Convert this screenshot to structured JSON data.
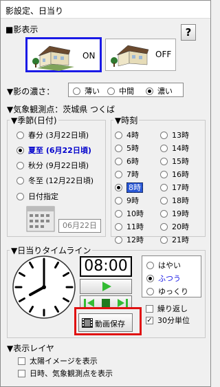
{
  "window": {
    "title": "影設定、日当り"
  },
  "shadow_display": {
    "title": "■影表示",
    "help_label": "?",
    "on_label": "ON",
    "off_label": "OFF"
  },
  "density": {
    "label": "▼影の濃さ：",
    "options": [
      "薄い",
      "中間",
      "濃い"
    ],
    "selected": "濃い"
  },
  "station": {
    "label": "▼気象観測点：茨城県 つくば"
  },
  "season": {
    "title": "▼季節(日付)",
    "options": [
      "春分 (3月22日頃)",
      "夏至 (6月22日頃)",
      "秋分 (9月22日頃)",
      "冬至 (12月22日頃)",
      "日付指定"
    ],
    "selected": "夏至 (6月22日頃)",
    "date_value": "06月22日"
  },
  "time": {
    "title": "▼時刻",
    "col1": [
      "4時",
      "5時",
      "6時",
      "7時",
      "8時",
      "9時",
      "10時",
      "11時",
      "12時"
    ],
    "col2": [
      "13時",
      "14時",
      "15時",
      "16時",
      "17時",
      "18時",
      "19時",
      "20時",
      "21時"
    ],
    "selected": "8時"
  },
  "timeline": {
    "title": "▼日当りタイムライン",
    "time_value": "08:00",
    "speed_options": [
      "はやい",
      "ふつう",
      "ゆっくり"
    ],
    "speed_selected": "ふつう",
    "repeat_label": "繰り返し",
    "unit_label": "30分単位",
    "save_label": "動画保存"
  },
  "layers": {
    "title": "▼表示レイヤ",
    "sun_image_label": "太陽イメージを表示",
    "datetime_label": "日時、気象観測点を表示"
  },
  "colors": {
    "selected_blue": "#1a1ae6",
    "highlight_red": "#e01010",
    "play_green": "#33bb33"
  }
}
